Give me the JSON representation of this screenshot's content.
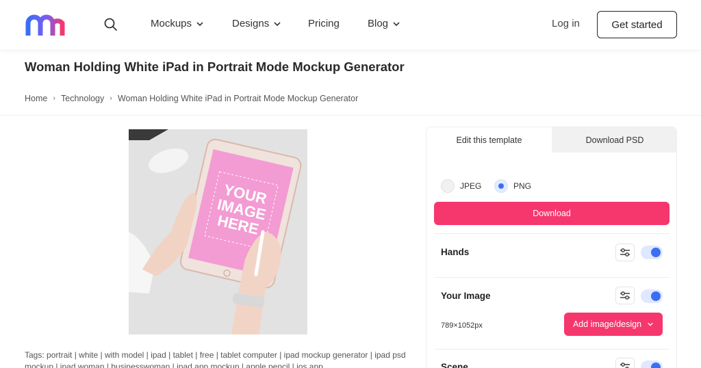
{
  "header": {
    "logo": "mediamodifier-m-logo",
    "nav": [
      {
        "label": "Mockups",
        "dropdown": true
      },
      {
        "label": "Designs",
        "dropdown": true
      },
      {
        "label": "Pricing",
        "dropdown": false
      },
      {
        "label": "Blog",
        "dropdown": true
      }
    ],
    "login_label": "Log in",
    "cta_label": "Get started"
  },
  "page": {
    "title": "Woman Holding White iPad in Portrait Mode Mockup Generator",
    "breadcrumb": [
      "Home",
      "Technology",
      "Woman Holding White iPad in Portrait Mode Mockup Generator"
    ]
  },
  "mockup": {
    "screen_text": [
      "YOUR",
      "IMAGE",
      "HERE"
    ]
  },
  "tags": {
    "text": "Tags: portrait | white | with model | ipad | tablet | free | tablet computer | ipad mockup generator | ipad psd mockup | ipad woman | businesswoman | ipad app mockup | apple pencil | ios app"
  },
  "panel": {
    "tabs": [
      "Edit this template",
      "Download PSD"
    ],
    "formats": [
      {
        "label": "JPEG",
        "selected": false
      },
      {
        "label": "PNG",
        "selected": true
      }
    ],
    "download_label": "Download",
    "layers": [
      {
        "title": "Hands",
        "enabled": true
      },
      {
        "title": "Your Image",
        "enabled": true,
        "dimensions": "789×1052px",
        "add_label": "Add image/design"
      },
      {
        "title": "Scene",
        "enabled": true
      }
    ]
  },
  "colors": {
    "accent": "#f5376d",
    "toggle": "#3b6ef5",
    "logo_blue": "#3b6ef5",
    "logo_pink": "#f5376d"
  }
}
